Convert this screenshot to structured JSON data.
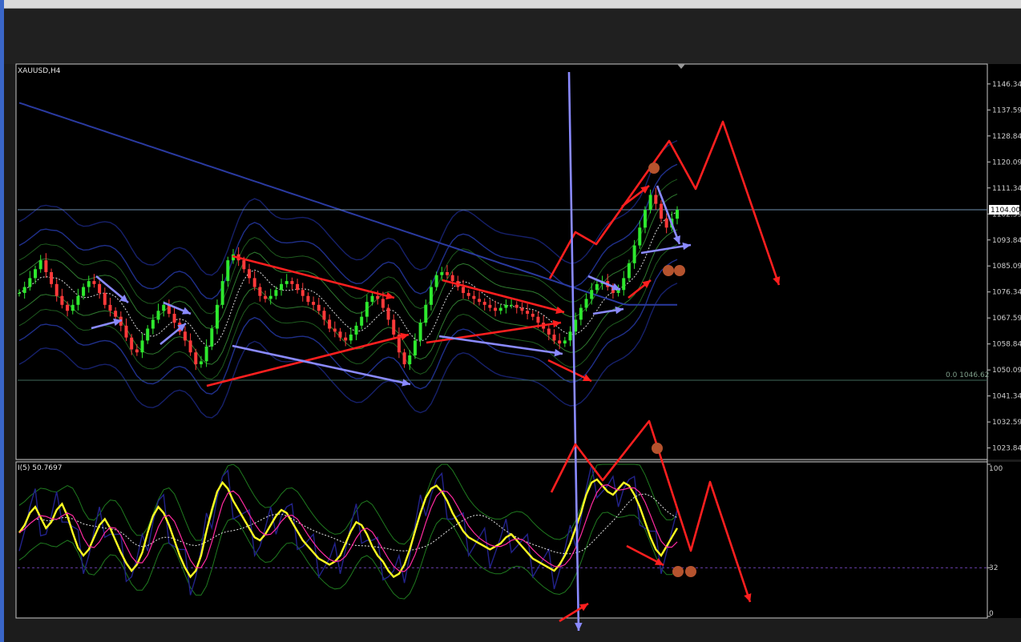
{
  "chart_data": [
    {
      "type": "candlestick",
      "title": "XAUUSD,H4",
      "y_ticks": [
        "1146.34",
        "1137.59",
        "1128.84",
        "1120.09",
        "1111.34",
        "1102.59",
        "1093.84",
        "1085.09",
        "1076.34",
        "1067.59",
        "1058.84",
        "1050.09",
        "1041.34",
        "1032.59",
        "1023.84"
      ],
      "ylim": [
        1020.5,
        1152.5
      ],
      "current_price_label": "1104.00",
      "current_price": 1104.0,
      "fib_label": "0.0 1046.62",
      "fib_level": 1046.62,
      "close_prices": [
        1076,
        1078,
        1081,
        1084,
        1087,
        1083,
        1079,
        1075,
        1072,
        1070,
        1072,
        1075,
        1078,
        1080,
        1079,
        1076,
        1072,
        1070,
        1068,
        1065,
        1061,
        1057,
        1056,
        1060,
        1064,
        1067,
        1070,
        1072,
        1069,
        1066,
        1063,
        1060,
        1056,
        1052,
        1053,
        1058,
        1064,
        1072,
        1080,
        1087,
        1089,
        1087,
        1084,
        1081,
        1078,
        1075,
        1074,
        1075,
        1077,
        1079,
        1080,
        1079,
        1077,
        1075,
        1073,
        1072,
        1070,
        1067,
        1064,
        1063,
        1061,
        1060,
        1062,
        1065,
        1068,
        1073,
        1075,
        1074,
        1071,
        1067,
        1062,
        1056,
        1052,
        1055,
        1060,
        1066,
        1072,
        1078,
        1082,
        1083,
        1082,
        1080,
        1078,
        1076,
        1075,
        1074,
        1073,
        1072,
        1071,
        1070,
        1071,
        1072,
        1072,
        1071,
        1070,
        1069,
        1068,
        1066,
        1064,
        1062,
        1060,
        1059,
        1060,
        1063,
        1067,
        1071,
        1074,
        1077,
        1079,
        1080,
        1078,
        1076,
        1077,
        1081,
        1086,
        1092,
        1098,
        1104,
        1109,
        1106,
        1101,
        1098,
        1101,
        1104
      ]
    },
    {
      "type": "line",
      "title": "I(5) 50.7697",
      "y_ticks": [
        "100",
        "32",
        "0"
      ],
      "ylim": [
        0,
        100
      ],
      "level": 32,
      "values": [
        55,
        60,
        68,
        72,
        65,
        58,
        62,
        70,
        74,
        66,
        55,
        45,
        40,
        44,
        52,
        60,
        64,
        58,
        50,
        42,
        35,
        30,
        34,
        42,
        55,
        66,
        72,
        68,
        60,
        50,
        40,
        32,
        26,
        30,
        40,
        56,
        70,
        82,
        88,
        84,
        76,
        70,
        64,
        58,
        52,
        50,
        54,
        60,
        66,
        70,
        68,
        62,
        56,
        50,
        46,
        42,
        38,
        36,
        34,
        36,
        40,
        48,
        56,
        62,
        60,
        54,
        46,
        40,
        36,
        30,
        26,
        28,
        34,
        44,
        56,
        68,
        78,
        84,
        86,
        82,
        76,
        68,
        62,
        56,
        52,
        50,
        48,
        46,
        44,
        46,
        48,
        52,
        54,
        50,
        46,
        42,
        38,
        36,
        34,
        32,
        30,
        34,
        40,
        48,
        58,
        68,
        80,
        88,
        90,
        86,
        82,
        80,
        84,
        88,
        86,
        80,
        72,
        62,
        52,
        44,
        40,
        46,
        52,
        58
      ]
    }
  ]
}
